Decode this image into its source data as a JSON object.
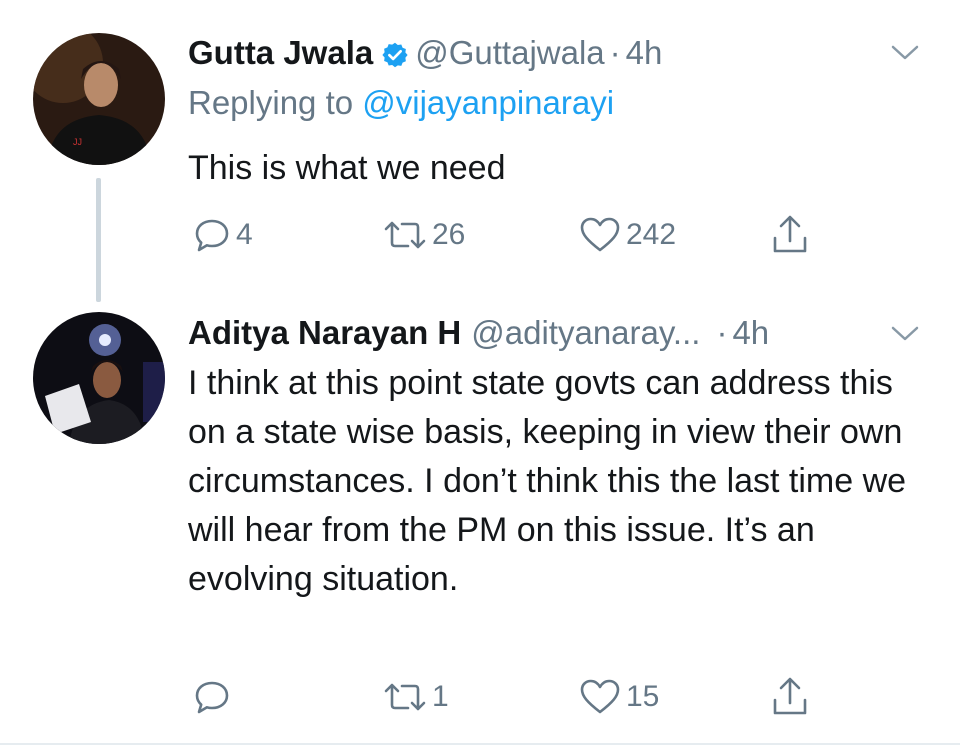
{
  "tweets": [
    {
      "name": "Gutta Jwala",
      "verified": true,
      "handle": "@Guttajwala",
      "sep": "·",
      "time": "4h",
      "reply_prefix": "Replying to ",
      "reply_to": "@vijayanpinarayi",
      "text": "This is what we need",
      "reply_count": "4",
      "retweet_count": "26",
      "like_count": "242"
    },
    {
      "name": "Aditya Narayan H",
      "verified": false,
      "handle": "@adityanaray...",
      "sep": "·",
      "time": "4h",
      "text": "I think at this point state govts can address this on a state wise basis, keeping in view their own circumstances. I don’t think this the last time we will hear from the PM on this issue. It’s an evolving situation.",
      "reply_count": "",
      "retweet_count": "1",
      "like_count": "15"
    }
  ],
  "colors": {
    "accent": "#1da1f2",
    "muted": "#657786",
    "text": "#14171a",
    "line": "#ccd6dd"
  },
  "icons": [
    "verified-badge-icon",
    "chevron-down-icon",
    "reply-icon",
    "retweet-icon",
    "heart-icon",
    "share-icon"
  ]
}
